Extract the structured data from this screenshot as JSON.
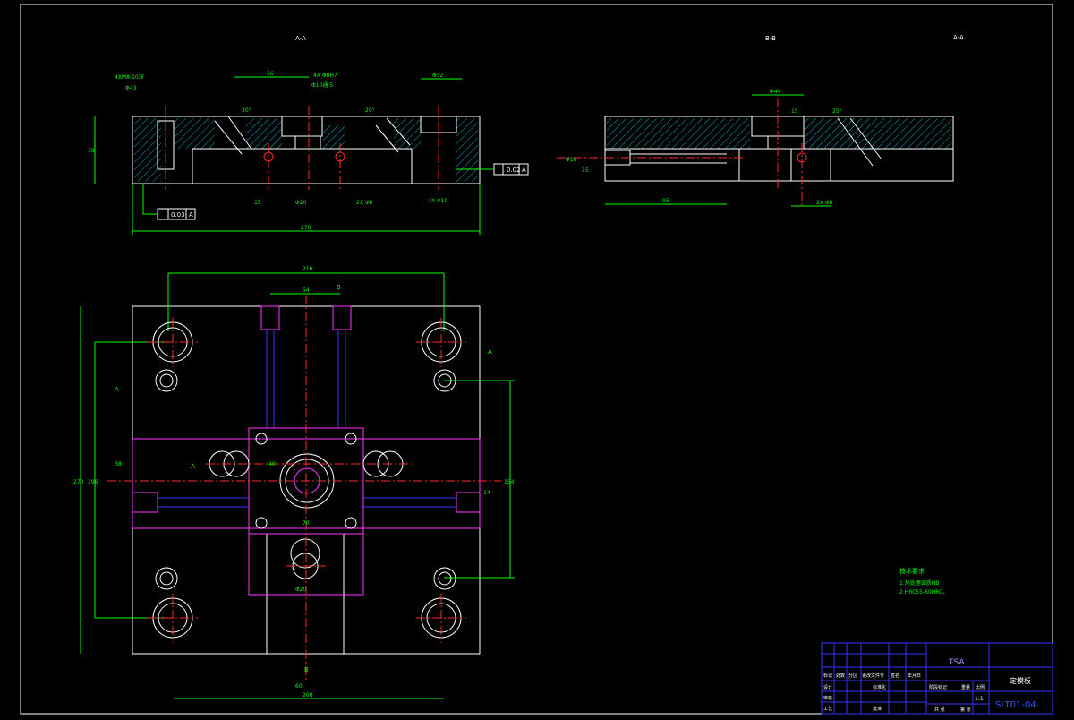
{
  "views": {
    "section_aa": "A-A",
    "section_bb": "B-B",
    "section_aa_small": "A-A"
  },
  "dims_aa": {
    "thread": "4XM8-10深",
    "hole": "Φ43",
    "d56": "56",
    "holes4": "4X Φ8H7",
    "thru": "Φ10通 5",
    "d30deg": "30°",
    "d38": "38",
    "phi12": "Φ12",
    "top_right": "Φ32",
    "d20deg": "20°",
    "tol_flat": "0.02",
    "tol_ref": "A",
    "phi20": "Φ20",
    "d2x8": "2X Φ8",
    "d4x": "4X Φ10",
    "par": "0.03",
    "par_ref": "A",
    "overall": "270",
    "d15": "15"
  },
  "dims_bb": {
    "d19": "Φ19",
    "d95": "95",
    "d44": "Φ44",
    "d15": "15",
    "d2x8": "2X Φ8",
    "d25deg": "25°",
    "d16": "Φ16",
    "d15b": "15"
  },
  "dims_plan": {
    "d216": "216",
    "d54": "54",
    "d270": "270",
    "d196": "196",
    "d208": "208",
    "d154": "154",
    "d38": "38",
    "d70": "70",
    "d40": "40",
    "d20": "Φ20",
    "d60": "60",
    "d14": "14",
    "b_label": "B",
    "a_label": "A"
  },
  "notes": {
    "title": "技术要求",
    "line1": "1.热处理调质HB",
    "line2": "2.HRC55-60HRC。"
  },
  "title_block": {
    "company": "TSA",
    "part_name": "定模板",
    "drawing_no": "SLT01-04",
    "scale": "1:1",
    "row_marks": [
      "标记",
      "处数",
      "分区",
      "更改文件号",
      "签名",
      "年月日"
    ],
    "design": "设计",
    "std": "标准化",
    "audit": "审核",
    "craft": "工艺",
    "approve": "批准",
    "stage": "阶段标记",
    "weight": "重量",
    "ratio": "比例",
    "sheets": "共 张",
    "sheet": "第 张"
  }
}
